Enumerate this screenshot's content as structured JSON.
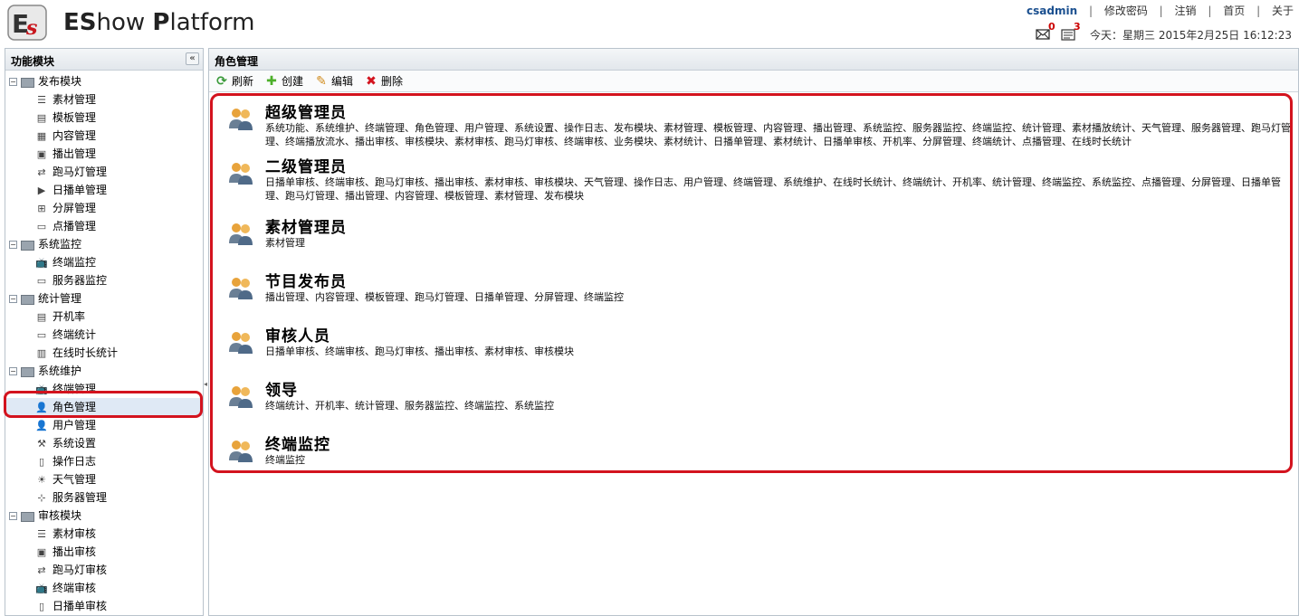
{
  "header": {
    "logo_bold": "ES",
    "logo_rest1": "how ",
    "logo_bold2": "P",
    "logo_rest2": "latform",
    "user": "csadmin",
    "links": [
      "修改密码",
      "注销",
      "首页",
      "关于"
    ],
    "mail_count": "0",
    "msg_count": "3",
    "date_text": "今天：星期三 2015年2月25日 16:12:23"
  },
  "sidebar": {
    "title": "功能模块",
    "collapse": "«",
    "groups": [
      {
        "label": "发布模块",
        "items": [
          "素材管理",
          "模板管理",
          "内容管理",
          "播出管理",
          "跑马灯管理",
          "日播单管理",
          "分屏管理",
          "点播管理"
        ]
      },
      {
        "label": "系统监控",
        "items": [
          "终端监控",
          "服务器监控"
        ]
      },
      {
        "label": "统计管理",
        "items": [
          "开机率",
          "终端统计",
          "在线时长统计"
        ]
      },
      {
        "label": "系统维护",
        "items": [
          "终端管理",
          "角色管理",
          "用户管理",
          "系统设置",
          "操作日志",
          "天气管理",
          "服务器管理"
        ]
      },
      {
        "label": "审核模块",
        "items": [
          "素材审核",
          "播出审核",
          "跑马灯审核",
          "终端审核",
          "日播单审核"
        ]
      }
    ]
  },
  "main": {
    "title": "角色管理",
    "toolbar": {
      "refresh": "刷新",
      "create": "创建",
      "edit": "编辑",
      "delete": "删除"
    },
    "roles": [
      {
        "name": "超级管理员",
        "perms": "系统功能、系统维护、终端管理、角色管理、用户管理、系统设置、操作日志、发布模块、素材管理、模板管理、内容管理、播出管理、系统监控、服务器监控、终端监控、统计管理、素材播放统计、天气管理、服务器管理、跑马灯管理、终端播放流水、播出审核、审核模块、素材审核、跑马灯审核、终端审核、业务模块、素材统计、日播单管理、素材统计、日播单审核、开机率、分屏管理、终端统计、点播管理、在线时长统计"
      },
      {
        "name": "二级管理员",
        "perms": "日播单审核、终端审核、跑马灯审核、播出审核、素材审核、审核模块、天气管理、操作日志、用户管理、终端管理、系统维护、在线时长统计、终端统计、开机率、统计管理、终端监控、系统监控、点播管理、分屏管理、日播单管理、跑马灯管理、播出管理、内容管理、模板管理、素材管理、发布模块"
      },
      {
        "name": "素材管理员",
        "perms": "素材管理"
      },
      {
        "name": "节目发布员",
        "perms": "播出管理、内容管理、模板管理、跑马灯管理、日播单管理、分屏管理、终端监控"
      },
      {
        "name": "审核人员",
        "perms": "日播单审核、终端审核、跑马灯审核、播出审核、素材审核、审核模块"
      },
      {
        "name": "领导",
        "perms": "终端统计、开机率、统计管理、服务器监控、终端监控、系统监控"
      },
      {
        "name": "终端监控",
        "perms": "终端监控"
      }
    ]
  },
  "colors": {
    "highlight": "#d3131e",
    "user_link": "#1a4f8f",
    "badge": "#cc0000"
  }
}
